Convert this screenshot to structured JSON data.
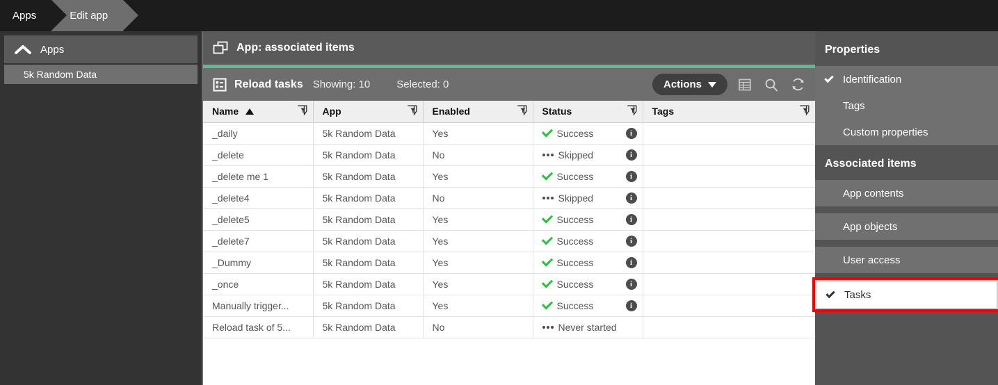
{
  "topbar": {
    "crumbs": [
      {
        "label": "Apps",
        "active": false
      },
      {
        "label": "Edit app",
        "active": true
      }
    ]
  },
  "sidebar": {
    "header": {
      "label": "Apps",
      "icon": "chevron-up-icon"
    },
    "items": [
      {
        "label": "5k Random Data"
      }
    ]
  },
  "main": {
    "title": "App: associated items",
    "title_icon": "copy-app-icon",
    "accent_color": "#61b894",
    "toolbar": {
      "icon": "reload-tasks-icon",
      "title": "Reload tasks",
      "showing_label": "Showing: 10",
      "selected_label": "Selected: 0",
      "actions_label": "Actions",
      "icons": [
        "table-columns-icon",
        "search-icon",
        "refresh-icon"
      ]
    },
    "table": {
      "columns": [
        {
          "label": "Name",
          "sorted": "asc",
          "filter": true
        },
        {
          "label": "App",
          "sorted": "",
          "filter": true
        },
        {
          "label": "Enabled",
          "sorted": "",
          "filter": true
        },
        {
          "label": "Status",
          "sorted": "",
          "filter": true
        },
        {
          "label": "Tags",
          "sorted": "",
          "filter": true
        }
      ],
      "rows": [
        {
          "name": "_daily",
          "app": "5k Random Data",
          "enabled": "Yes",
          "status": "Success",
          "status_icon": "check-icon",
          "info": true,
          "tags": ""
        },
        {
          "name": "_delete",
          "app": "5k Random Data",
          "enabled": "No",
          "status": "Skipped",
          "status_icon": "dots-icon",
          "info": true,
          "tags": ""
        },
        {
          "name": "_delete me 1",
          "app": "5k Random Data",
          "enabled": "Yes",
          "status": "Success",
          "status_icon": "check-icon",
          "info": true,
          "tags": ""
        },
        {
          "name": "_delete4",
          "app": "5k Random Data",
          "enabled": "No",
          "status": "Skipped",
          "status_icon": "dots-icon",
          "info": true,
          "tags": ""
        },
        {
          "name": "_delete5",
          "app": "5k Random Data",
          "enabled": "Yes",
          "status": "Success",
          "status_icon": "check-icon",
          "info": true,
          "tags": ""
        },
        {
          "name": "_delete7",
          "app": "5k Random Data",
          "enabled": "Yes",
          "status": "Success",
          "status_icon": "check-icon",
          "info": true,
          "tags": ""
        },
        {
          "name": "_Dummy",
          "app": "5k Random Data",
          "enabled": "Yes",
          "status": "Success",
          "status_icon": "check-icon",
          "info": true,
          "tags": ""
        },
        {
          "name": "_once",
          "app": "5k Random Data",
          "enabled": "Yes",
          "status": "Success",
          "status_icon": "check-icon",
          "info": true,
          "tags": ""
        },
        {
          "name": "Manually trigger...",
          "app": "5k Random Data",
          "enabled": "Yes",
          "status": "Success",
          "status_icon": "check-icon",
          "info": true,
          "tags": ""
        },
        {
          "name": "Reload task of 5...",
          "app": "5k Random Data",
          "enabled": "No",
          "status": "Never started",
          "status_icon": "dots-icon",
          "info": false,
          "tags": ""
        }
      ]
    }
  },
  "properties": {
    "sections": [
      {
        "title": "Properties",
        "items": [
          {
            "label": "Identification",
            "checked": true,
            "selected": false
          },
          {
            "label": "Tags",
            "checked": false,
            "selected": false
          },
          {
            "label": "Custom properties",
            "checked": false,
            "selected": false
          }
        ]
      },
      {
        "title": "Associated items",
        "items": [
          {
            "label": "App contents",
            "checked": false,
            "selected": false
          },
          {
            "label": "App objects",
            "checked": false,
            "selected": false
          },
          {
            "label": "User access",
            "checked": false,
            "selected": false
          },
          {
            "label": "Tasks",
            "checked": true,
            "selected": true
          }
        ]
      }
    ],
    "highlight_color": "#f80000"
  }
}
